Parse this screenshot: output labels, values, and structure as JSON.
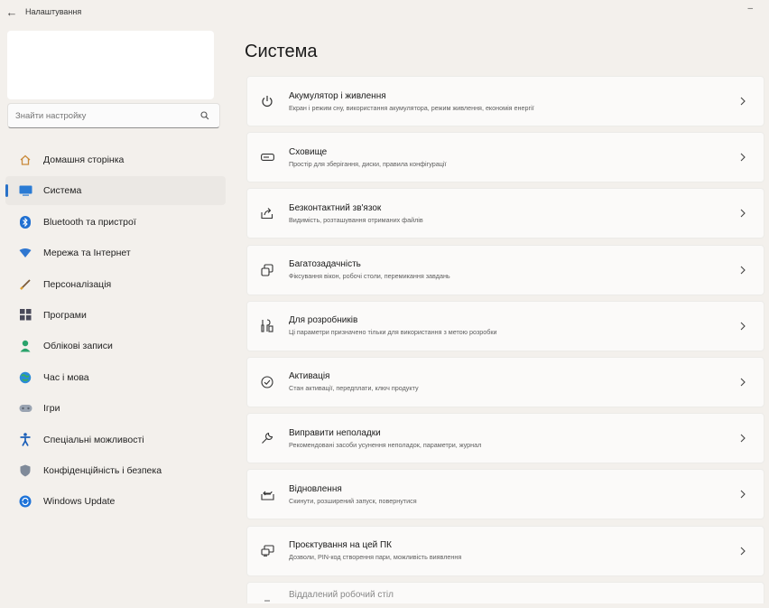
{
  "app": {
    "title": "Налаштування",
    "back_glyph": "←",
    "minimize_glyph": "–"
  },
  "sidebar": {
    "search_placeholder": "Знайти настройку",
    "items": [
      {
        "label": "Домашня сторінка",
        "icon": "home-icon",
        "selected": false
      },
      {
        "label": "Система",
        "icon": "system-icon",
        "selected": true
      },
      {
        "label": "Bluetooth та пристрої",
        "icon": "bluetooth-icon",
        "selected": false
      },
      {
        "label": "Мережа та Інтернет",
        "icon": "network-icon",
        "selected": false
      },
      {
        "label": "Персоналізація",
        "icon": "personalization-icon",
        "selected": false
      },
      {
        "label": "Програми",
        "icon": "apps-icon",
        "selected": false
      },
      {
        "label": "Облікові записи",
        "icon": "accounts-icon",
        "selected": false
      },
      {
        "label": "Час і мова",
        "icon": "time-language-icon",
        "selected": false
      },
      {
        "label": "Ігри",
        "icon": "gaming-icon",
        "selected": false
      },
      {
        "label": "Спеціальні можливості",
        "icon": "accessibility-icon",
        "selected": false
      },
      {
        "label": "Конфіденційність і безпека",
        "icon": "privacy-shield-icon",
        "selected": false
      },
      {
        "label": "Windows Update",
        "icon": "windows-update-icon",
        "selected": false
      }
    ]
  },
  "main": {
    "title": "Система",
    "chevron_glyph": "›",
    "cards": [
      {
        "title": "Акумулятор і живлення",
        "subtitle": "Екран і режим сну, використання акумулятора, режим живлення, економія енергії",
        "icon": "power-icon"
      },
      {
        "title": "Сховище",
        "subtitle": "Простір для зберігання, диски, правила конфігурації",
        "icon": "storage-icon"
      },
      {
        "title": "Безконтактний зв'язок",
        "subtitle": "Видимість, розташування отриманих файлів",
        "icon": "nearby-sharing-icon"
      },
      {
        "title": "Багатозадачність",
        "subtitle": "Фіксування вікон, робочі столи, перемикання завдань",
        "icon": "multitasking-icon"
      },
      {
        "title": "Для розробників",
        "subtitle": "Ці параметри призначено тільки для використання з метою розробки",
        "icon": "developer-tools-icon"
      },
      {
        "title": "Активація",
        "subtitle": "Стан активації, передплати, ключ продукту",
        "icon": "activation-check-icon"
      },
      {
        "title": "Виправити неполадки",
        "subtitle": "Рекомендовані засоби усунення неполадок, параметри, журнал",
        "icon": "troubleshoot-wrench-icon"
      },
      {
        "title": "Відновлення",
        "subtitle": "Скинути, розширений запуск, повернутися",
        "icon": "recovery-icon"
      },
      {
        "title": "Проєктування на цей ПК",
        "subtitle": "Дозволи, PIN-код створення пари, можливість виявлення",
        "icon": "projecting-icon"
      }
    ],
    "partial_card_title": "Віддалений робочий стіл"
  },
  "colors": {
    "background": "#f3f0ec",
    "card": "#fbfaf9",
    "accent": "#2a72c8",
    "selected_item": "#ebe8e4"
  }
}
